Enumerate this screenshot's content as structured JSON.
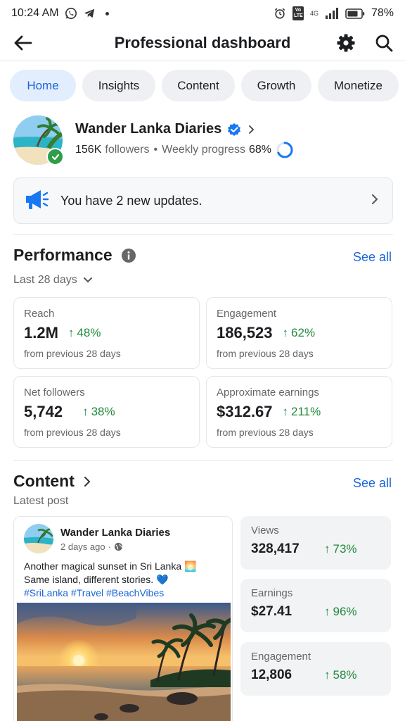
{
  "status_bar": {
    "time": "10:24 AM",
    "battery": "78%",
    "icons": [
      "whatsapp-icon",
      "telegram-icon",
      "alarm-icon",
      "volte-icon",
      "4g-icon",
      "signal-icon",
      "battery-icon"
    ],
    "volte_label": "Vo LTE",
    "network_label": "4G"
  },
  "header": {
    "title": "Professional dashboard",
    "icons": [
      "back-arrow-icon",
      "gear-icon",
      "search-icon"
    ]
  },
  "tabs": [
    {
      "label": "Home",
      "active": true
    },
    {
      "label": "Insights",
      "active": false
    },
    {
      "label": "Content",
      "active": false
    },
    {
      "label": "Growth",
      "active": false
    },
    {
      "label": "Monetize",
      "active": false
    }
  ],
  "profile": {
    "name": "Wander Lanka Diaries",
    "followers": "156K",
    "followers_label": "followers",
    "weekly_progress_label": "Weekly progress",
    "weekly_progress": "68%",
    "weekly_progress_value": 0.68
  },
  "updates": {
    "text": "You have 2 new updates."
  },
  "performance": {
    "title": "Performance",
    "see_all": "See all",
    "date_range": "Last 28 days",
    "metrics": [
      {
        "label": "Reach",
        "value": "1.2M",
        "change": "48%",
        "sub": "from previous 28 days"
      },
      {
        "label": "Engagement",
        "value": "186,523",
        "change": "62%",
        "sub": "from previous 28 days"
      },
      {
        "label": "Net followers",
        "value": "5,742",
        "change": "38%",
        "sub": "from previous 28 days"
      },
      {
        "label": "Approximate earnings",
        "value": "$312.67",
        "change": "211%",
        "sub": "from previous 28 days"
      }
    ]
  },
  "content": {
    "title": "Content",
    "see_all": "See all",
    "latest_post_label": "Latest post",
    "post": {
      "author": "Wander Lanka Diaries",
      "time": "2 days ago",
      "text_line1": "Another magical sunset in Sri Lanka 🌅",
      "text_line2": "Same island, different stories. 💙",
      "hashtags": "#SriLanka #Travel #BeachVibes"
    },
    "stats": [
      {
        "label": "Views",
        "value": "328,417",
        "change": "73%"
      },
      {
        "label": "Earnings",
        "value": "$27.41",
        "change": "96%"
      },
      {
        "label": "Engagement",
        "value": "12,806",
        "change": "58%"
      }
    ]
  },
  "colors": {
    "accent": "#1a66d9",
    "positive": "#1f8a3a",
    "tab_active_bg": "#e2eefd",
    "tab_bg": "#eef0f3"
  }
}
